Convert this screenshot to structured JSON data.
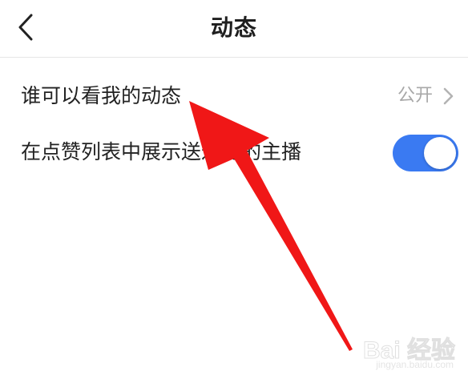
{
  "header": {
    "title": "动态",
    "back_icon": "chevron-left-icon"
  },
  "settings": {
    "items": [
      {
        "label": "谁可以看我的动态",
        "value": "公开",
        "icon": "chevron-right-icon"
      },
      {
        "label": "在点赞列表中展示送过礼的主播",
        "toggle_on": true
      }
    ]
  },
  "colors": {
    "toggle_on": "#3a7af2",
    "annotation_arrow": "#f01717",
    "value_text": "#a8a8a8",
    "divider": "#e6e6e6"
  },
  "watermark": {
    "main": "Bai 经验",
    "sub": "jingyan.baidu.com"
  }
}
